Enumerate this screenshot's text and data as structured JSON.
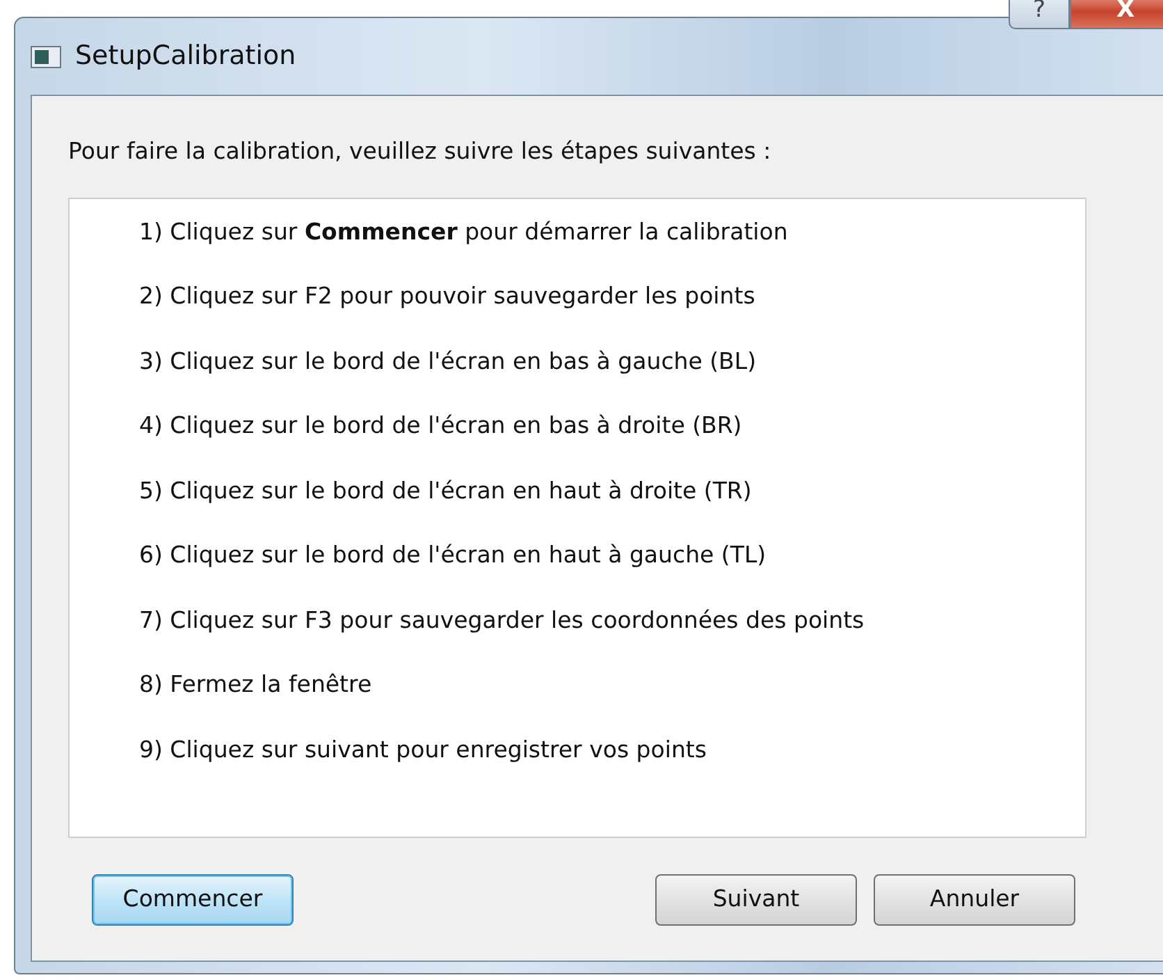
{
  "window": {
    "title": "SetupCalibration",
    "help_button": "?",
    "close_button": "X"
  },
  "instruction": "Pour faire la calibration, veuillez suivre les étapes suivantes :",
  "steps": [
    "1) Cliquez sur **Commencer** pour démarrer la calibration",
    "2) Cliquez sur F2 pour pouvoir sauvegarder les points",
    "3) Cliquez sur le bord de l'écran en bas à gauche (BL)",
    "4) Cliquez sur le bord de l'écran en bas à droite (BR)",
    "5) Cliquez sur le bord de l'écran en haut à droite (TR)",
    "6) Cliquez sur le bord de l'écran en haut à gauche (TL)",
    "7) Cliquez sur F3 pour sauvegarder les coordonnées des points",
    "8) Fermez la fenêtre",
    "9) Cliquez sur suivant pour enregistrer vos points"
  ],
  "buttons": [
    {
      "label": "Commencer",
      "default": true
    },
    {
      "label": "Suivant",
      "default": false
    },
    {
      "label": "Annuler",
      "default": false
    }
  ]
}
